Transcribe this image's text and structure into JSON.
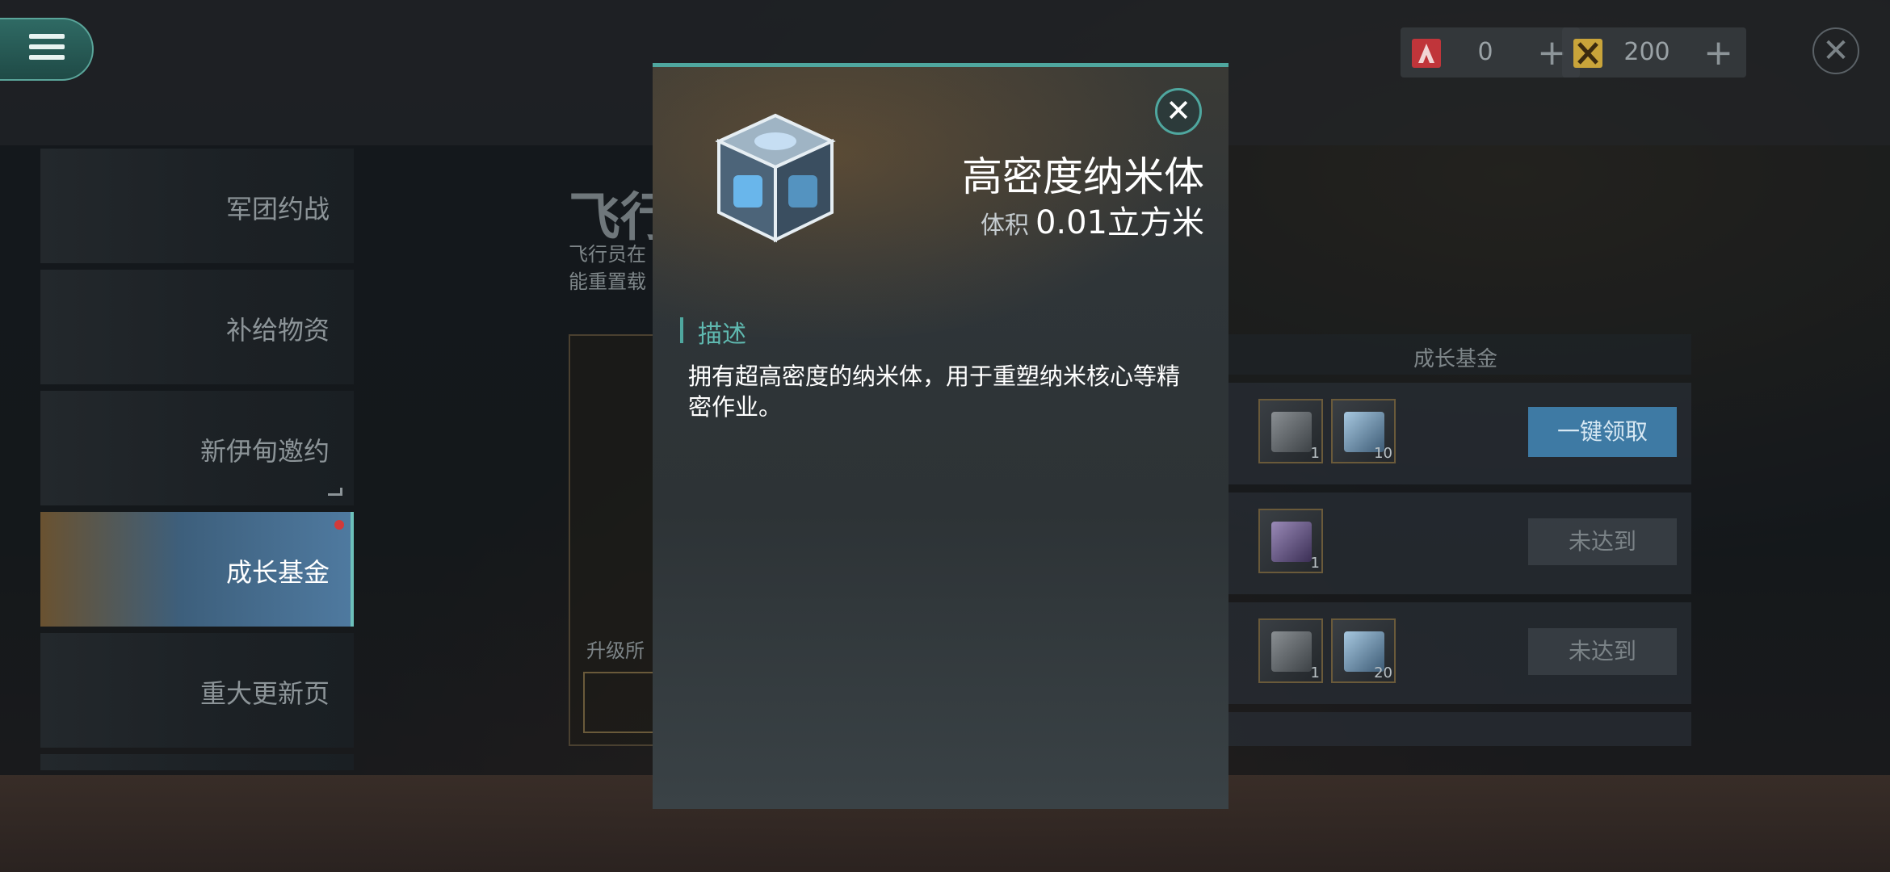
{
  "topbar": {
    "currency": [
      {
        "icon": "red-a-emblem-icon",
        "value": "0",
        "color": "#c0353a"
      },
      {
        "icon": "gold-x-emblem-icon",
        "value": "200",
        "color": "#c9a43a"
      }
    ]
  },
  "sidebar": {
    "items": [
      {
        "label": "军团约战"
      },
      {
        "label": "补给物资"
      },
      {
        "label": "新伊甸邀约"
      },
      {
        "label": "成长基金"
      },
      {
        "label": "重大更新页"
      }
    ]
  },
  "content": {
    "title_fragment": "飞行",
    "desc_lines": [
      "飞行员在",
      "能重置载"
    ],
    "upgrade_label": "升级所"
  },
  "fund": {
    "header": "成长基金",
    "rows": [
      {
        "items": [
          {
            "icon": "supply-crate-icon",
            "count": "1"
          },
          {
            "icon": "nano-cube-icon",
            "count": "10"
          }
        ],
        "button": "一键领取",
        "state": "claimable"
      },
      {
        "items": [
          {
            "icon": "purple-crate-icon",
            "count": "1"
          }
        ],
        "button": "未达到",
        "state": "locked"
      },
      {
        "items": [
          {
            "icon": "supply-crate-icon",
            "count": "1"
          },
          {
            "icon": "nano-cube-icon",
            "count": "20"
          }
        ],
        "button": "未达到",
        "state": "locked"
      }
    ]
  },
  "modal": {
    "item_name": "高密度纳米体",
    "volume_label": "体积",
    "volume_value": "0.01立方米",
    "section_title": "描述",
    "description": "拥有超高密度的纳米体，用于重塑纳米核心等精密作业。",
    "close_symbol": "✕"
  },
  "colors": {
    "accent": "#4fa79f",
    "claim_button": "#3e7aa4",
    "badge": "#d23a3a"
  }
}
